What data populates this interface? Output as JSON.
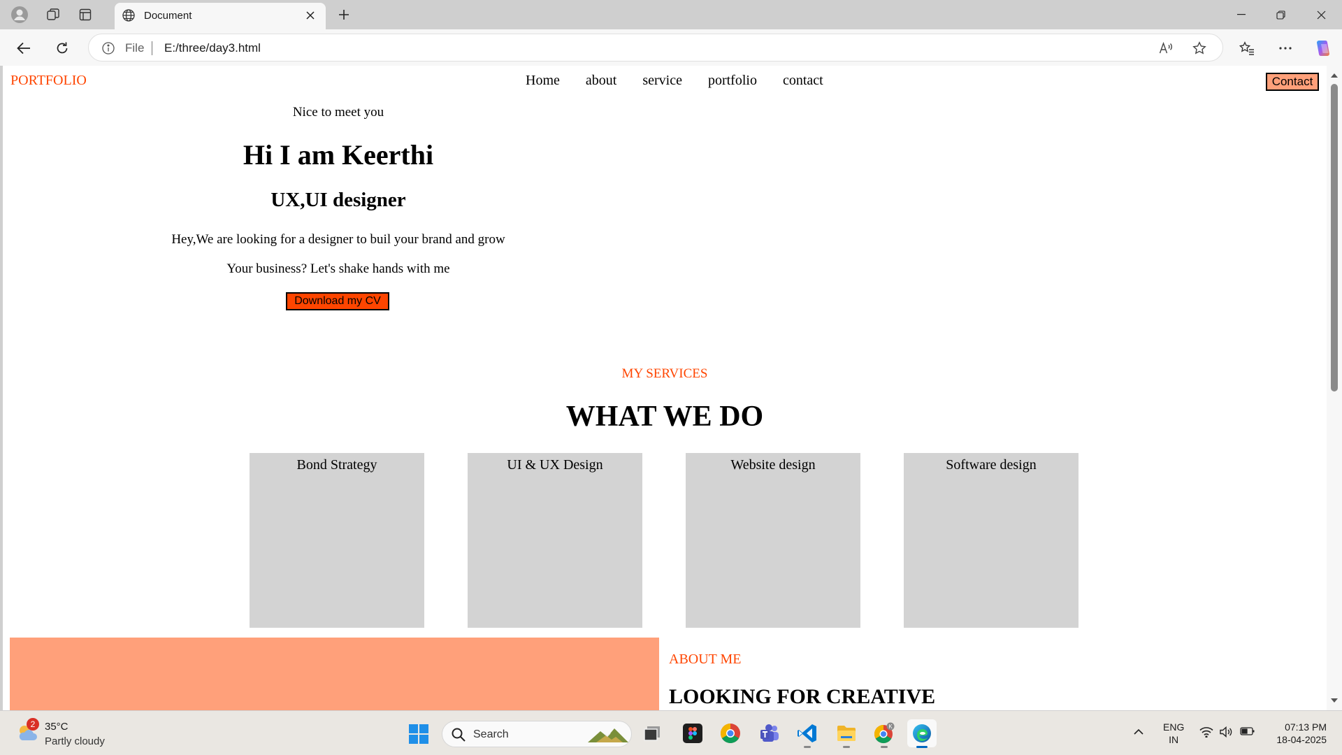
{
  "browser": {
    "tab_title": "Document",
    "omnibox": {
      "scheme_label": "File",
      "url": "E:/three/day3.html"
    }
  },
  "page": {
    "logo": "PORTFOLIO",
    "nav": [
      "Home",
      "about",
      "service",
      "portfolio",
      "contact"
    ],
    "contact_button": "Contact",
    "hero": {
      "greeting": "Nice to meet you",
      "name": "Hi I am Keerthi",
      "role": "UX,UI designer",
      "para1": "Hey,We are looking for a designer to buil your brand and grow",
      "para2": "Your business? Let's shake hands with me",
      "cv_button": "Download my CV"
    },
    "services": {
      "tag": "MY SERVICES",
      "title": "WHAT WE DO",
      "cards": [
        "Bond Strategy",
        "UI & UX Design",
        "Website design",
        "Software design"
      ]
    },
    "about": {
      "tag": "ABOUT ME",
      "title": "LOOKING FOR CREATIVE"
    },
    "colors": {
      "accent": "#ff4500",
      "light_salmon": "#ffa07a",
      "card_gray": "#d3d3d3"
    }
  },
  "taskbar": {
    "weather": {
      "badge": "2",
      "temp": "35°C",
      "desc": "Partly cloudy"
    },
    "search_label": "Search",
    "apps": [
      "task-view-icon",
      "figma-icon",
      "chrome-icon",
      "teams-icon",
      "vscode-icon",
      "file-explorer-icon",
      "chrome-profile-icon",
      "edge-icon"
    ],
    "lang": {
      "line1": "ENG",
      "line2": "IN"
    },
    "clock": {
      "time": "07:13 PM",
      "date": "18-04-2025"
    }
  }
}
